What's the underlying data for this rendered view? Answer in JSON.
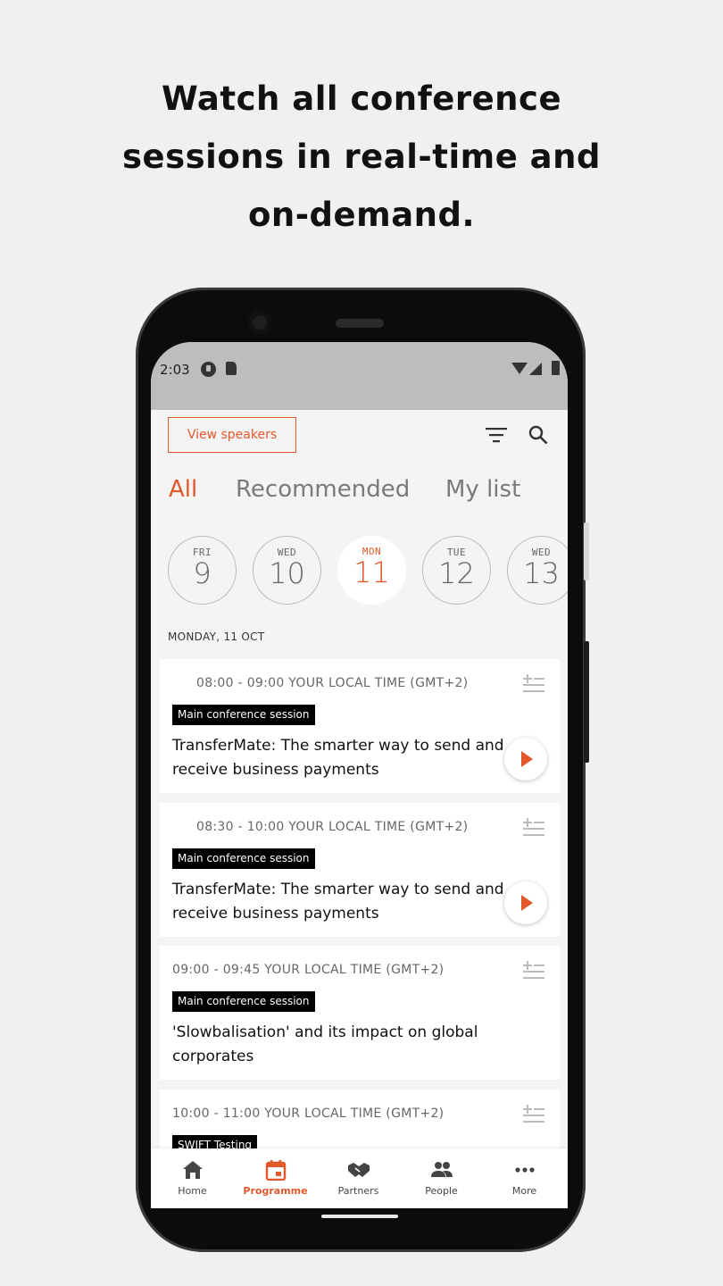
{
  "headline": [
    "Watch all conference",
    "sessions in real-time and",
    "on-demand."
  ],
  "status_bar": {
    "time": "2:03"
  },
  "toolbar": {
    "view_speakers_label": "View speakers"
  },
  "tabs": [
    {
      "label": "All",
      "active": true
    },
    {
      "label": "Recommended",
      "active": false
    },
    {
      "label": "My list",
      "active": false
    }
  ],
  "dates": [
    {
      "dow": "FRI",
      "day": "9",
      "active": false
    },
    {
      "dow": "WED",
      "day": "10",
      "active": false
    },
    {
      "dow": "MON",
      "day": "11",
      "active": true
    },
    {
      "dow": "TUE",
      "day": "12",
      "active": false
    },
    {
      "dow": "WED",
      "day": "13",
      "active": false
    }
  ],
  "date_heading": "MONDAY, 11 OCT",
  "sessions": [
    {
      "time": "08:00 - 09:00 YOUR LOCAL TIME (GMT+2)",
      "badge": "Main conference session",
      "title": "TransferMate: The smarter way to send and receive business payments",
      "playable": true
    },
    {
      "time": "08:30 - 10:00 YOUR LOCAL TIME (GMT+2)",
      "badge": "Main conference session",
      "title": "TransferMate: The smarter way to send and receive business payments",
      "playable": true
    },
    {
      "time": "09:00 - 09:45 YOUR LOCAL TIME (GMT+2)",
      "badge": "Main conference session",
      "title": "'Slowbalisation' and its impact on global corporates",
      "playable": false
    },
    {
      "time": "10:00 - 11:00 YOUR LOCAL TIME (GMT+2)",
      "badge": "SWIFT Testing",
      "title": "",
      "playable": false
    }
  ],
  "bottom_nav": [
    {
      "label": "Home",
      "icon": "home-icon",
      "active": false
    },
    {
      "label": "Programme",
      "icon": "calendar-icon",
      "active": true
    },
    {
      "label": "Partners",
      "icon": "handshake-icon",
      "active": false
    },
    {
      "label": "People",
      "icon": "people-icon",
      "active": false
    },
    {
      "label": "More",
      "icon": "more-icon",
      "active": false
    }
  ],
  "colors": {
    "accent": "#e2582a",
    "background": "#f0f0f0"
  }
}
